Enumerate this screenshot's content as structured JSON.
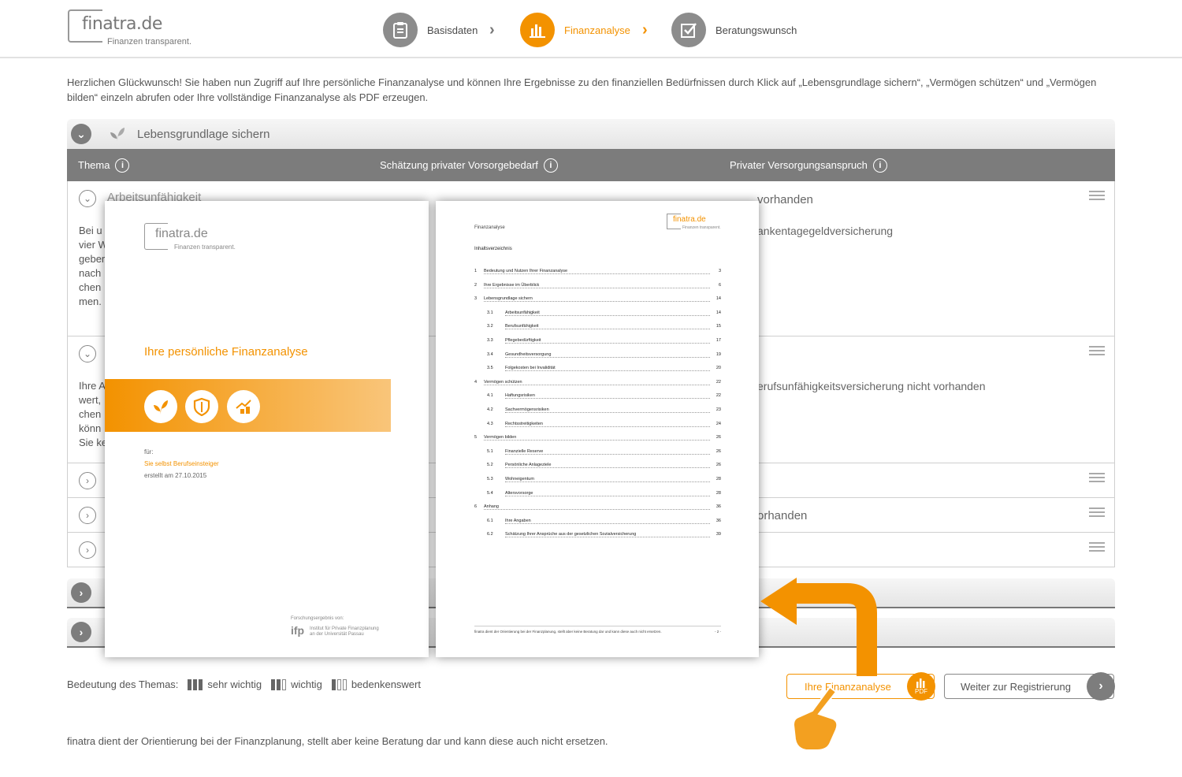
{
  "header": {
    "logo_name": "finatra.de",
    "logo_tagline": "Finanzen transparent.",
    "steps": [
      {
        "label": "Basisdaten",
        "icon": "clipboard-icon"
      },
      {
        "label": "Finanzanalyse",
        "icon": "bar-chart-icon"
      },
      {
        "label": "Beratungswunsch",
        "icon": "checkbox-icon"
      }
    ]
  },
  "intro": "Herzlichen Glückwunsch! Sie haben nun Zugriff auf Ihre persönliche Finanzanalyse und können Ihre Ergebnisse zu den finanziellen Bedürfnissen durch Klick auf „Lebensgrundlage sichern“, „Vermögen schützen“ und „Vermögen bilden“ einzeln abrufen oder Ihre vollständige Finanzanalyse als PDF erzeugen.",
  "section": {
    "title": "Lebensgrundlage sichern",
    "columns": {
      "thema": "Thema",
      "schaetzung": "Schätzung privater Vorsorgebedarf",
      "anspruch": "Privater Versorgungsanspruch"
    },
    "rows": [
      {
        "title": "Arbeitsunfähigkeit",
        "text_fragment": "Bei u vier W geber nach chen men.",
        "claim": "vorhanden",
        "claim_detail": "ankentagegeldversicherung"
      },
      {
        "text_fragment": "Ihre A wert, chen könn Sie ke",
        "claim_detail": "erufsunfähigkeitsversicherung nicht vorhanden"
      },
      {},
      {
        "claim": "orhanden"
      },
      {}
    ]
  },
  "legend": {
    "label": "Bedeutung des Themas:",
    "items": [
      "sehr wichtig",
      "wichtig",
      "bedenkenswert"
    ]
  },
  "buttons": {
    "finanzanalyse": "Ihre Finanzanalyse",
    "pdf": "PDF",
    "registrierung": "Weiter zur Registrierung"
  },
  "footer": "finatra dient der Orientierung bei der Finanzplanung, stellt aber keine Beratung dar und kann diese auch nicht ersetzen.",
  "pdf_cover": {
    "logo_name": "finatra",
    "logo_ext": ".de",
    "logo_tagline": "Finanzen transparent.",
    "title": "Ihre persönliche Finanzanalyse",
    "for_label": "für:",
    "for_name": "Sie selbst Berufseinsteiger",
    "created": "erstellt am 27.10.2015",
    "source_label": "Forschungsergebnis von:",
    "source_logo": "ifp",
    "source_line1": "Institut für Private Finanzplanung",
    "source_line2": "an der Universität Passau"
  },
  "pdf_toc": {
    "header": "Finanzanalyse",
    "logo": "finatra.de",
    "logo_tagline": "Finanzen transparent.",
    "heading": "Inhaltsverzeichnis",
    "entries": [
      {
        "no": "1",
        "text": "Bedeutung und Nutzen Ihrer Finanzanalyse",
        "page": "3",
        "sub": false
      },
      {
        "no": "2",
        "text": "Ihre Ergebnisse im Überblick",
        "page": "6",
        "sub": false
      },
      {
        "no": "3",
        "text": "Lebensgrundlage sichern",
        "page": "14",
        "sub": false
      },
      {
        "no": "3.1",
        "text": "Arbeitsunfähigkeit",
        "page": "14",
        "sub": true
      },
      {
        "no": "3.2",
        "text": "Berufsunfähigkeit",
        "page": "15",
        "sub": true
      },
      {
        "no": "3.3",
        "text": "Pflegebedürftigkeit",
        "page": "17",
        "sub": true
      },
      {
        "no": "3.4",
        "text": "Gesundheitsversorgung",
        "page": "19",
        "sub": true
      },
      {
        "no": "3.5",
        "text": "Folgekosten bei Invalidität",
        "page": "20",
        "sub": true
      },
      {
        "no": "4",
        "text": "Vermögen schützen",
        "page": "22",
        "sub": false
      },
      {
        "no": "4.1",
        "text": "Haftungsrisiken",
        "page": "22",
        "sub": true
      },
      {
        "no": "4.2",
        "text": "Sachvermögensrisiken",
        "page": "23",
        "sub": true
      },
      {
        "no": "4.3",
        "text": "Rechtsstreitigkeiten",
        "page": "24",
        "sub": true
      },
      {
        "no": "5",
        "text": "Vermögen bilden",
        "page": "26",
        "sub": false
      },
      {
        "no": "5.1",
        "text": "Finanzielle Reserve",
        "page": "26",
        "sub": true
      },
      {
        "no": "5.2",
        "text": "Persönliche Anlageziele",
        "page": "26",
        "sub": true
      },
      {
        "no": "5.3",
        "text": "Wohneigentum",
        "page": "28",
        "sub": true
      },
      {
        "no": "5.4",
        "text": "Altersvorsorge",
        "page": "28",
        "sub": true
      },
      {
        "no": "6",
        "text": "Anhang",
        "page": "36",
        "sub": false
      },
      {
        "no": "6.1",
        "text": "Ihre Angaben",
        "page": "36",
        "sub": true
      },
      {
        "no": "6.2",
        "text": "Schätzung Ihrer Ansprüche aus der gesetzlichen Sozialversicherung",
        "page": "39",
        "sub": true
      }
    ],
    "footer_text": "finatra dient der Orientierung bei der Finanzplanung, stellt aber keine Beratung dar und kann diese auch nicht ersetzen.",
    "page_no": "- 2 -"
  },
  "colors": {
    "accent": "#f39200",
    "gray": "#7c7c7c"
  }
}
